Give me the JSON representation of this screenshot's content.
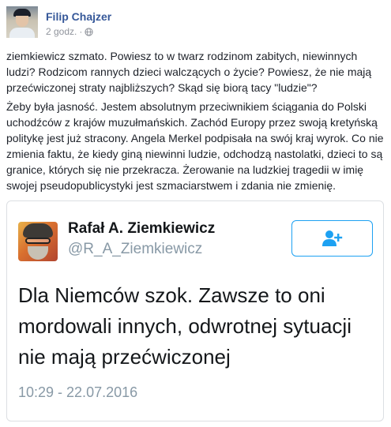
{
  "post": {
    "author": "Filip Chajzer",
    "timestamp": "2 godz.",
    "separator": "·",
    "privacy_icon": "globe-icon",
    "paragraphs": [
      "ziemkiewicz szmato. Powiesz to w twarz rodzinom zabitych, niewinnych ludzi? Rodzicom rannych dzieci walczących o życie? Powiesz, że nie mają przećwiczonej straty najbliższych? Skąd się biorą tacy \"ludzie\"?",
      "Żeby była jasność. Jestem absolutnym przeciwnikiem ściągania do Polski uchodźców z krajów muzułmańskich. Zachód Europy przez swoją kretyńską politykę jest już stracony. Angela Merkel podpisała na swój kraj wyrok. Co nie zmienia faktu, że kiedy giną niewinni ludzie, odchodzą nastolatki, dzieci to są granice, których się nie przekracza. Żerowanie na ludzkiej tragedii w imię swojej pseudopublicystyki jest szmaciarstwem i zdania nie zmienię."
    ]
  },
  "tweet": {
    "name": "Rafał A. Ziemkiewicz",
    "handle": "@R_A_Ziemkiewicz",
    "text": "Dla Niemców szok. Zawsze to oni mordowali innych, odwrotnej sytuacji nie mają przećwiczonej",
    "time": "10:29 - 22.07.2016",
    "follow_icon": "add-user-icon"
  },
  "colors": {
    "facebook_link": "#365899",
    "twitter_blue": "#1da1f2",
    "muted_gray": "#8899a6"
  }
}
